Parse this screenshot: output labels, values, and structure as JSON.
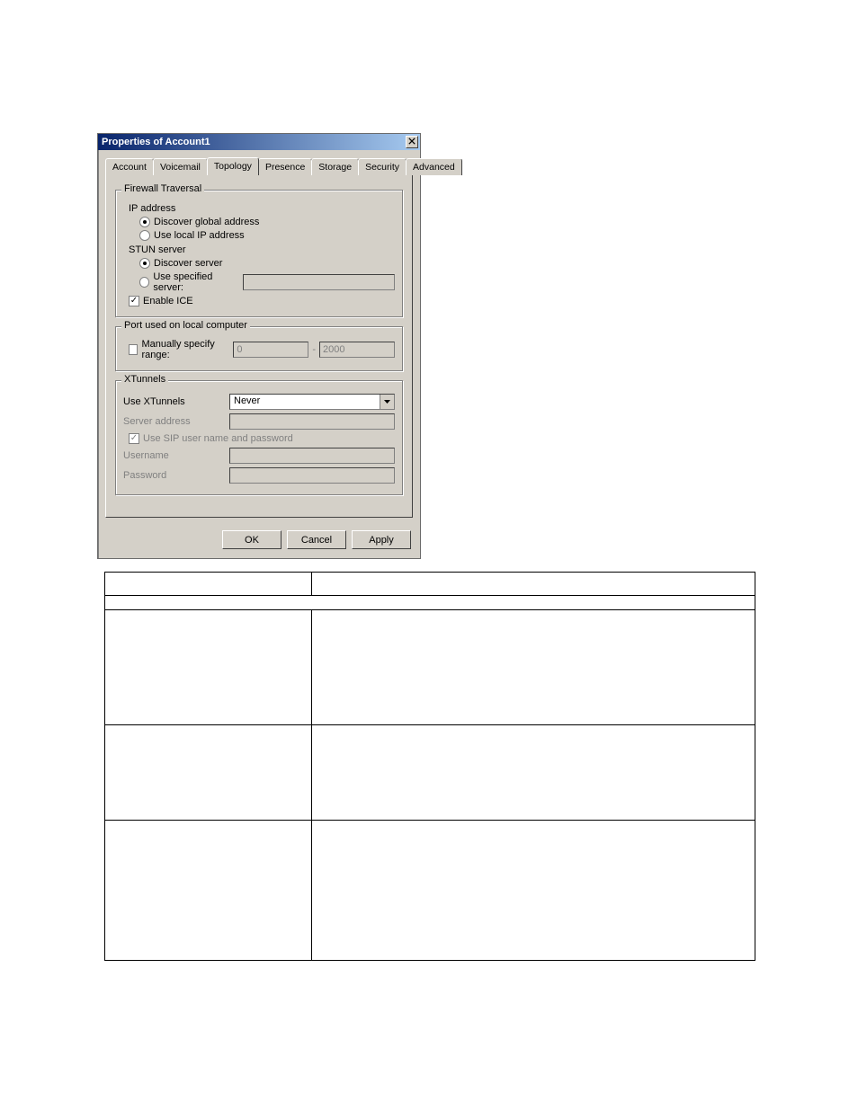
{
  "dialog": {
    "title": "Properties of Account1",
    "tabs": [
      "Account",
      "Voicemail",
      "Topology",
      "Presence",
      "Storage",
      "Security",
      "Advanced"
    ],
    "active_tab_index": 2
  },
  "firewall": {
    "legend": "Firewall Traversal",
    "ip_label": "IP address",
    "ip_option_discover": "Discover global address",
    "ip_option_local": "Use local IP address",
    "stun_label": "STUN server",
    "stun_option_discover": "Discover server",
    "stun_option_specified": "Use specified server:",
    "stun_server_value": "",
    "enable_ice": "Enable ICE"
  },
  "port": {
    "legend": "Port used on local computer",
    "manual_label": "Manually specify range:",
    "range_low": "0",
    "range_sep": "-",
    "range_high": "2000"
  },
  "xtunnels": {
    "legend": "XTunnels",
    "use_label": "Use XTunnels",
    "use_value": "Never",
    "server_label": "Server address",
    "use_sip_label": "Use SIP user name and password",
    "username_label": "Username",
    "password_label": "Password",
    "server_value": "",
    "username_value": "",
    "password_value": ""
  },
  "buttons": {
    "ok": "OK",
    "cancel": "Cancel",
    "apply": "Apply"
  }
}
